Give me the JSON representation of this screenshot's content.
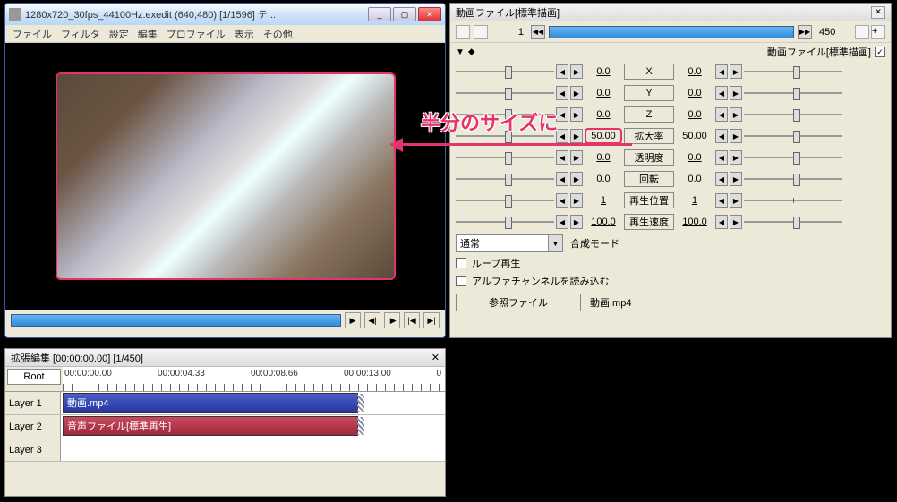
{
  "main_window": {
    "title": "1280x720_30fps_44100Hz.exedit (640,480) [1/1596] テ...",
    "menu": {
      "file": "ファイル",
      "filter": "フィルタ",
      "settings": "設定",
      "edit": "編集",
      "profile": "プロファイル",
      "view": "表示",
      "other": "その他"
    },
    "rewind_glyph": "|◄"
  },
  "props_window": {
    "title": "動画ファイル[標準描画]",
    "frame_start": "1",
    "frame_end": "450",
    "header_label": "動画ファイル[標準描画]",
    "mouse_glyph": "⬥",
    "params": [
      {
        "key": "x",
        "left": "0.0",
        "label": "X",
        "right": "0.0"
      },
      {
        "key": "y",
        "left": "0.0",
        "label": "Y",
        "right": "0.0"
      },
      {
        "key": "z",
        "left": "0.0",
        "label": "Z",
        "right": "0.0"
      },
      {
        "key": "scale",
        "left": "50.00",
        "label": "拡大率",
        "right": "50.00",
        "highlight": true
      },
      {
        "key": "alpha",
        "left": "0.0",
        "label": "透明度",
        "right": "0.0"
      },
      {
        "key": "rot",
        "left": "0.0",
        "label": "回転",
        "right": "0.0"
      },
      {
        "key": "playpos",
        "left": "1",
        "label": "再生位置",
        "right": "1",
        "rslider_off": true
      },
      {
        "key": "playspd",
        "left": "100.0",
        "label": "再生速度",
        "right": "100.0"
      }
    ],
    "blend_label": "合成モード",
    "blend_value": "通常",
    "loop": "ループ再生",
    "alpha_ch": "アルファチャンネルを読み込む",
    "ref_btn": "参照ファイル",
    "ref_val": "動画.mp4"
  },
  "timeline": {
    "title": "拡張編集 [00:00:00.00] [1/450]",
    "root": "Root",
    "times": [
      "00:00:00.00",
      "00:00:04.33",
      "00:00:08.66",
      "00:00:13.00"
    ],
    "scroll_zero": "0",
    "layers": [
      "Layer 1",
      "Layer 2",
      "Layer 3"
    ],
    "clip_video": "動画.mp4",
    "clip_audio": "音声ファイル[標準再生]"
  },
  "annotation": "半分のサイズに"
}
